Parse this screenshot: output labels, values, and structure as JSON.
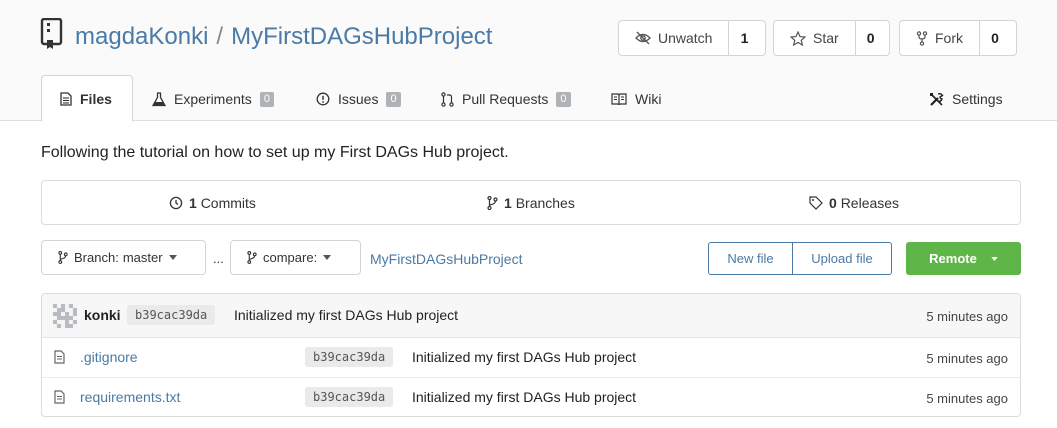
{
  "repo": {
    "owner": "magdaKonki",
    "separator": "/",
    "name": "MyFirstDAGsHubProject"
  },
  "actions": {
    "watch": {
      "label": "Unwatch",
      "count": "1"
    },
    "star": {
      "label": "Star",
      "count": "0"
    },
    "fork": {
      "label": "Fork",
      "count": "0"
    }
  },
  "tabs": [
    {
      "label": "Files"
    },
    {
      "label": "Experiments",
      "badge": "0"
    },
    {
      "label": "Issues",
      "badge": "0"
    },
    {
      "label": "Pull Requests",
      "badge": "0"
    },
    {
      "label": "Wiki"
    },
    {
      "label": "Settings"
    }
  ],
  "description": "Following the tutorial on how to set up my First DAGs Hub project.",
  "stats": {
    "commits": {
      "count": "1",
      "label": "Commits"
    },
    "branches": {
      "count": "1",
      "label": "Branches"
    },
    "releases": {
      "count": "0",
      "label": "Releases"
    }
  },
  "toolbar": {
    "branch_prefix": "Branch:",
    "branch_value": "master",
    "ellipsis": "...",
    "compare_label": "compare:",
    "breadcrumb": "MyFirstDAGsHubProject",
    "new_file": "New file",
    "upload_file": "Upload file",
    "remote": "Remote"
  },
  "latest_commit": {
    "author": "konki",
    "sha": "b39cac39da",
    "message": "Initialized my first DAGs Hub project",
    "age": "5 minutes ago"
  },
  "files": [
    {
      "name": ".gitignore",
      "sha": "b39cac39da",
      "message": "Initialized my first DAGs Hub project",
      "age": "5 minutes ago"
    },
    {
      "name": "requirements.txt",
      "sha": "b39cac39da",
      "message": "Initialized my first DAGs Hub project",
      "age": "5 minutes ago"
    }
  ],
  "colors": {
    "link": "#4a7aa5",
    "remote_button": "#5fb648",
    "badge": "#b0b3b5"
  }
}
